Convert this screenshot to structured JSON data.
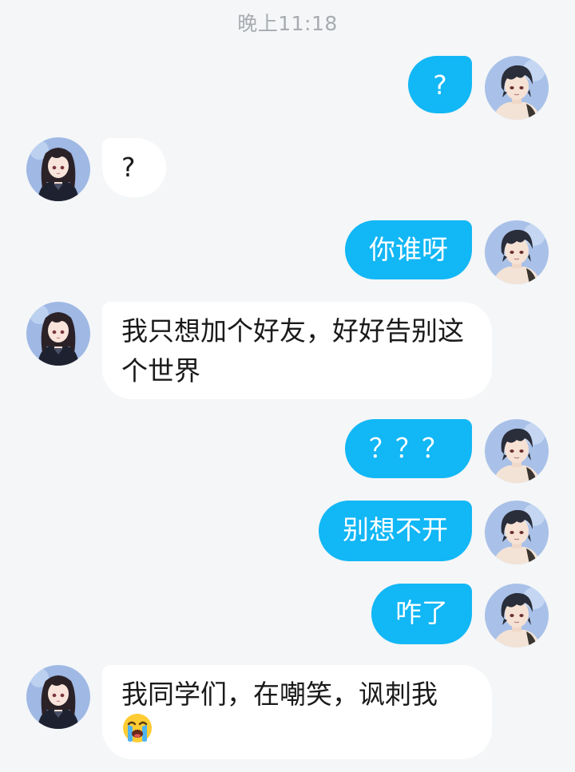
{
  "chat": {
    "timestamp": "晚上11:18",
    "messages": [
      {
        "sender": "me",
        "text": "?"
      },
      {
        "sender": "other",
        "text": "?"
      },
      {
        "sender": "me",
        "text": "你谁呀"
      },
      {
        "sender": "other",
        "text": "我只想加个好友，好好告别这个世界"
      },
      {
        "sender": "me",
        "text": "？？？"
      },
      {
        "sender": "me",
        "text": "别想不开"
      },
      {
        "sender": "me",
        "text": "咋了"
      },
      {
        "sender": "other",
        "text": "我同学们，在嘲笑，讽刺我",
        "emoji": "loudly-crying-face-icon"
      }
    ]
  },
  "colors": {
    "background": "#f4f6f8",
    "my_bubble": "#12b7f5",
    "other_bubble": "#ffffff",
    "timestamp_text": "#a8abb0"
  }
}
